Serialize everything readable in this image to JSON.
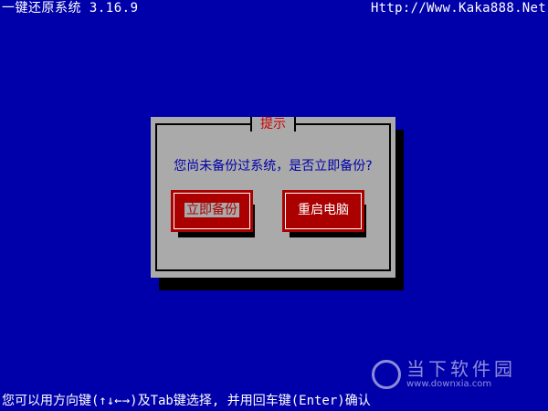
{
  "header": {
    "app_title": "一键还原系统 3.16.9",
    "website": "Http://Www.Kaka888.Net"
  },
  "dialog": {
    "title": "提示",
    "message": "您尚未备份过系统，是否立即备份?",
    "buttons": [
      {
        "label": "立即备份",
        "focused": true
      },
      {
        "label": "重启电脑",
        "focused": false
      }
    ]
  },
  "footer": {
    "hint": "您可以用方向键(↑↓←→)及Tab键选择, 并用回车键(Enter)确认"
  },
  "watermark": {
    "name": "当下软件园",
    "url": "www.downxia.com"
  },
  "colors": {
    "background": "#0000aa",
    "dialog": "#aaaaaa",
    "button": "#aa0000",
    "title": "#cc0000",
    "message": "#0000aa",
    "text": "#ffffff"
  }
}
